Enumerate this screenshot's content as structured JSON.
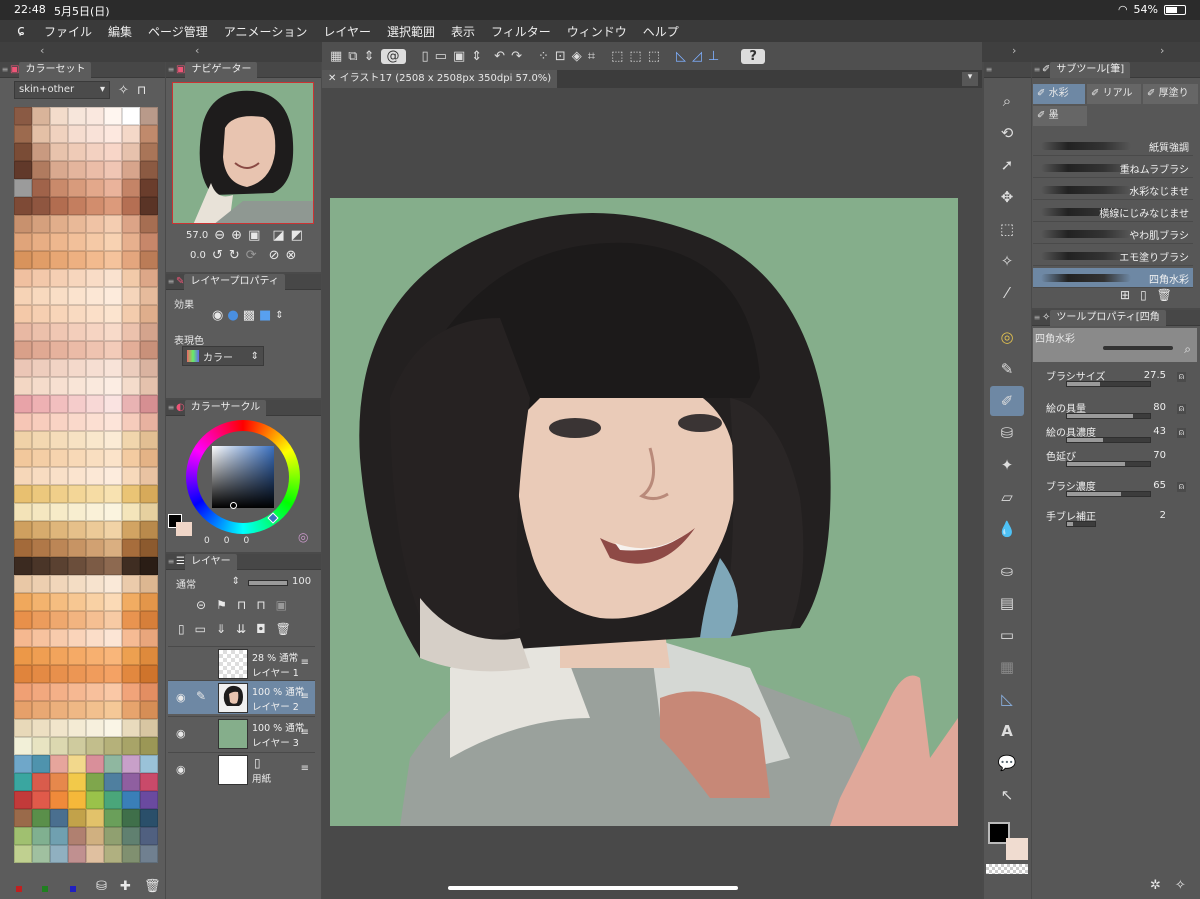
{
  "status": {
    "time": "22:48",
    "date": "5月5日(日)",
    "battery": "54%",
    "battery_level": 0.54
  },
  "menu": [
    "ファイル",
    "編集",
    "ページ管理",
    "アニメーション",
    "レイヤー",
    "選択範囲",
    "表示",
    "フィルター",
    "ウィンドウ",
    "ヘルプ"
  ],
  "color_set": {
    "tab": "カラーセット",
    "set_name": "skin+other",
    "swatches": [
      "#8a5a44",
      "#d9b49a",
      "#f3dccb",
      "#f7e6db",
      "#fae8df",
      "#fff6f0",
      "#ffffff",
      "#b99a8a",
      "#9c6a4e",
      "#e4c0a6",
      "#f0d2bf",
      "#f6ddd0",
      "#f9e2d8",
      "#fde8df",
      "#f4d8c8",
      "#c08a6c",
      "#7a4c36",
      "#c99a80",
      "#e8c3ac",
      "#efcbb7",
      "#f3d1c1",
      "#f8d6c8",
      "#e7c2ad",
      "#a97558",
      "#61392a",
      "#b07b5f",
      "#d9a98f",
      "#e4b59d",
      "#ebbda8",
      "#f0c6b4",
      "#d7a58c",
      "#8b5a42",
      "#9b9b9b",
      "#a0634a",
      "#c98a6b",
      "#d89b7c",
      "#e3a88b",
      "#eab39b",
      "#c48467",
      "#6a3d2c",
      "#7e4a36",
      "#8f5640",
      "#b26d50",
      "#c47e5f",
      "#d28d6d",
      "#dc9a7b",
      "#b56f53",
      "#5a3426",
      "#c8916e",
      "#d5a07d",
      "#e1ae8b",
      "#e9b998",
      "#f0c3a5",
      "#f4cdb1",
      "#dca487",
      "#a66e52",
      "#e0a47a",
      "#e8ae84",
      "#eeb78e",
      "#f2c09a",
      "#f5c9a6",
      "#f8d2b2",
      "#e7b08e",
      "#c7876a",
      "#d8935c",
      "#e19d67",
      "#e8a774",
      "#edb081",
      "#f2ba8e",
      "#f5c39c",
      "#e4a67e",
      "#bb7c57",
      "#f0c0a0",
      "#f3c8aa",
      "#f5cfb3",
      "#f7d6bd",
      "#f9dcc6",
      "#fae2cf",
      "#f2caa9",
      "#dda788",
      "#f6d3b6",
      "#f8d9be",
      "#f9dec6",
      "#fbe3ce",
      "#fce7d5",
      "#fdebdc",
      "#f5d5bb",
      "#e6bb9c",
      "#f4c9a9",
      "#f6cfb1",
      "#f8d5b9",
      "#f9dac1",
      "#fbdfc8",
      "#fce4cf",
      "#f3ccad",
      "#dfae8c",
      "#e8b8a3",
      "#ecc0ab",
      "#f0c7b3",
      "#f3cebb",
      "#f6d4c2",
      "#f8dac9",
      "#ecc2ad",
      "#d4a48d",
      "#d9a089",
      "#e0a993",
      "#e6b29d",
      "#ebbba7",
      "#efc3b0",
      "#f3cbb9",
      "#e3ae98",
      "#c9917a",
      "#ebc6b6",
      "#eecdbd",
      "#f1d3c4",
      "#f4d9cb",
      "#f6ded2",
      "#f8e3d8",
      "#eccdbd",
      "#dab3a0",
      "#f3d7c4",
      "#f5dccb",
      "#f7e0d1",
      "#f9e5d7",
      "#fae9dd",
      "#fcede3",
      "#f4dccb",
      "#e5c2ad",
      "#e8a3a8",
      "#eeb1b3",
      "#f2bfbf",
      "#f5cccb",
      "#f8d8d6",
      "#fae3e1",
      "#e9b3b3",
      "#d68f92",
      "#f6c6b6",
      "#f8cdbd",
      "#f9d3c4",
      "#fad9cb",
      "#fcdfd2",
      "#fde4d9",
      "#f6ccbc",
      "#e8b2a0",
      "#f0d2a8",
      "#f3d8b1",
      "#f5ddba",
      "#f7e2c3",
      "#f9e7cc",
      "#fbebd5",
      "#f1d6ad",
      "#e2bf93",
      "#f2c89c",
      "#f4cea5",
      "#f6d3ae",
      "#f8d9b7",
      "#f9dec0",
      "#fbe3c9",
      "#f3cba1",
      "#e4b386",
      "#f6d7b9",
      "#f8dcc1",
      "#f9e0c8",
      "#fbe4cf",
      "#fce8d6",
      "#fdecdd",
      "#f7d9bb",
      "#e9c3a2",
      "#e8c070",
      "#ecc87d",
      "#f0cf8a",
      "#f3d697",
      "#f6dca4",
      "#f8e2b1",
      "#eac475",
      "#d7aa5a",
      "#f3e3b8",
      "#f5e7c0",
      "#f7ebc8",
      "#f8eed0",
      "#faf1d8",
      "#fbf4df",
      "#f4e5bb",
      "#e6d09f",
      "#cfa05f",
      "#d7ab6d",
      "#dfb67b",
      "#e6c08a",
      "#ecca98",
      "#f1d3a6",
      "#d2a463",
      "#b98a4c",
      "#a36a3a",
      "#b07848",
      "#bc8656",
      "#c79464",
      "#d1a172",
      "#daaf81",
      "#a76d3c",
      "#8c5a2e",
      "#3b2a20",
      "#4a3528",
      "#5a4131",
      "#6b4e3b",
      "#7c5b45",
      "#8d6950",
      "#3f2d22",
      "#2a1d15",
      "#e9c8a6",
      "#edcfb0",
      "#f1d6ba",
      "#f4ddc4",
      "#f7e3ce",
      "#fae9d8",
      "#ebcbab",
      "#ddb791",
      "#f0a85c",
      "#f3b36e",
      "#f5bd80",
      "#f7c792",
      "#f9d1a4",
      "#fbdab6",
      "#f1ac62",
      "#e3964a",
      "#e8904a",
      "#ec9c5c",
      "#efa86e",
      "#f2b480",
      "#f5bf92",
      "#f7caa4",
      "#e99450",
      "#d67f3a",
      "#f5b890",
      "#f7c29e",
      "#f8cbac",
      "#fad4ba",
      "#fbddc8",
      "#fce5d5",
      "#f6bb94",
      "#e9a67c",
      "#ec9848",
      "#ef9e52",
      "#f2a45c",
      "#f5aa66",
      "#f7b070",
      "#f9b67a",
      "#eda050",
      "#de8a3c",
      "#e0843c",
      "#e48a44",
      "#e8904c",
      "#ec9654",
      "#f09c5c",
      "#f4a264",
      "#e2883f",
      "#cf742c",
      "#f0a074",
      "#f2a87e",
      "#f4b088",
      "#f6b892",
      "#f8c09c",
      "#fac8a6",
      "#f1a47a",
      "#e38e62",
      "#e6a06a",
      "#e9a873",
      "#ecb07c",
      "#efb885",
      "#f2c08e",
      "#f5c897",
      "#e7a46d",
      "#d68e56",
      "#e8d9b9",
      "#eddfc2",
      "#f1e5cb",
      "#f4ebd4",
      "#f7f0dd",
      "#faf5e6",
      "#e9dbbd",
      "#d8c6a2",
      "#f2f0d8",
      "#e8e4c2",
      "#dcd8b0",
      "#cfcb9e",
      "#c2be8c",
      "#b5b17a",
      "#a8a468",
      "#9b9756",
      "#6fa7c9",
      "#4f93ad",
      "#e6a59c",
      "#f2d88c",
      "#d98f9a",
      "#8fb7a0",
      "#c8a0c9",
      "#9ac2d8",
      "#3aa6a0",
      "#d95c4c",
      "#e6884c",
      "#f2c94a",
      "#7fa64c",
      "#4f7f9f",
      "#8f5fa0",
      "#c94a6a",
      "#c23a3a",
      "#e05a4a",
      "#f08a3a",
      "#f5b83a",
      "#9ac24a",
      "#4aa67a",
      "#3a7fb8",
      "#6a4aa0",
      "#9a6a4a",
      "#5a8f4a",
      "#4a6f8f",
      "#c2a24a",
      "#e2c26a",
      "#6a9f5a",
      "#3f6f4a",
      "#2a4f6a",
      "#a0c070",
      "#80b090",
      "#70a0b0",
      "#b08070",
      "#d0b080",
      "#90a070",
      "#608070",
      "#506080",
      "#c0d090",
      "#a0c0a0",
      "#90b0c0",
      "#c09090",
      "#e0c0a0",
      "#b0b080",
      "#809070",
      "#708090",
      "#e0e0a0",
      "#c0e0c0",
      "#a0d0e0",
      "#e0b0b0",
      "#f0d0b0",
      "#d0d090",
      "#a0b080",
      "#90a0b0",
      "#6a8a5a",
      "#5a7a8a",
      "#8a6a8a",
      "#aa7a5a",
      "#7a9a6a",
      "#5a8a9a",
      "#9a7a9a",
      "#ba8a6a",
      "#3a5a4a",
      "#2a4a5a",
      "#5a3a5a",
      "#7a4a3a",
      "#4a6a4a",
      "#3a5a6a",
      "#6a4a6a",
      "#8a5a4a",
      "#d8e8a0",
      "#c8d890",
      "#e8d8a0",
      "#f0c890",
      "#a8d8c8",
      "#98c8d8",
      "#c8b8d8",
      "#e8b8c8",
      "#7a7a7a",
      "#8a8a8a",
      "#9a9a9a",
      "#aaaaaa",
      "#bababa",
      "#cacaca",
      "#dadada",
      "#eaeaea",
      "#2a2a2a",
      "#3a3a3a",
      "#4a4a4a",
      "#5a5a5a",
      "#000000",
      "#1a1a1a",
      "#6a6a6a",
      "#ffffff",
      "#c85a5a",
      "#5aa05a",
      "#5a5ac8",
      "#c8c85a",
      "#5ac8c8",
      "#c85ac8",
      "#e8e8e8",
      "#888888"
    ],
    "bottom_dots": [
      "#c02020",
      "#208020",
      "#2020c0"
    ]
  },
  "navigator": {
    "tab": "ナビゲーター",
    "zoom": "57.0",
    "rotation": "0.0"
  },
  "layer_property": {
    "tab": "レイヤープロパティ",
    "effect_label": "効果",
    "color_label": "表現色",
    "color_value": "カラー"
  },
  "color_circle": {
    "tab": "カラーサークル",
    "values": [
      "0",
      "0",
      "0"
    ]
  },
  "layers": {
    "tab": "レイヤー",
    "blend": "通常",
    "opacity": "100",
    "items": [
      {
        "pct": "28 % 通常",
        "name": "レイヤー 1"
      },
      {
        "pct": "100 % 通常",
        "name": "レイヤー 2"
      },
      {
        "pct": "100 % 通常",
        "name": "レイヤー 3"
      },
      {
        "pct": "",
        "name": "用紙"
      }
    ]
  },
  "canvas": {
    "tab": "イラスト17 (2508 x 2508px 350dpi 57.0%)"
  },
  "subtool": {
    "tab": "サブツール[筆]",
    "tabs": [
      "水彩",
      "リアル",
      "厚塗り",
      "墨"
    ],
    "brushes": [
      "紙質強調",
      "重ねムラブラシ",
      "水彩なじませ",
      "横線にじみなじませ",
      "やわ肌ブラシ",
      "エモ塗りブラシ",
      "四角水彩"
    ]
  },
  "tool_property": {
    "tab": "ツールプロパティ[四角",
    "brush": "四角水彩",
    "props": [
      {
        "label": "ブラシサイズ",
        "value": "27.5",
        "level": 0.4
      },
      {
        "label": "絵の具量",
        "value": "80",
        "level": 0.8
      },
      {
        "label": "絵の具濃度",
        "value": "43",
        "level": 0.43
      },
      {
        "label": "色延び",
        "value": "70",
        "level": 0.7
      },
      {
        "label": "ブラシ濃度",
        "value": "65",
        "level": 0.65
      },
      {
        "label": "手ブレ補正",
        "value": "2",
        "level": 0.2
      }
    ]
  },
  "colors": {
    "canvas_bg": "#85ae8b",
    "accent": "#4a7fb5"
  }
}
